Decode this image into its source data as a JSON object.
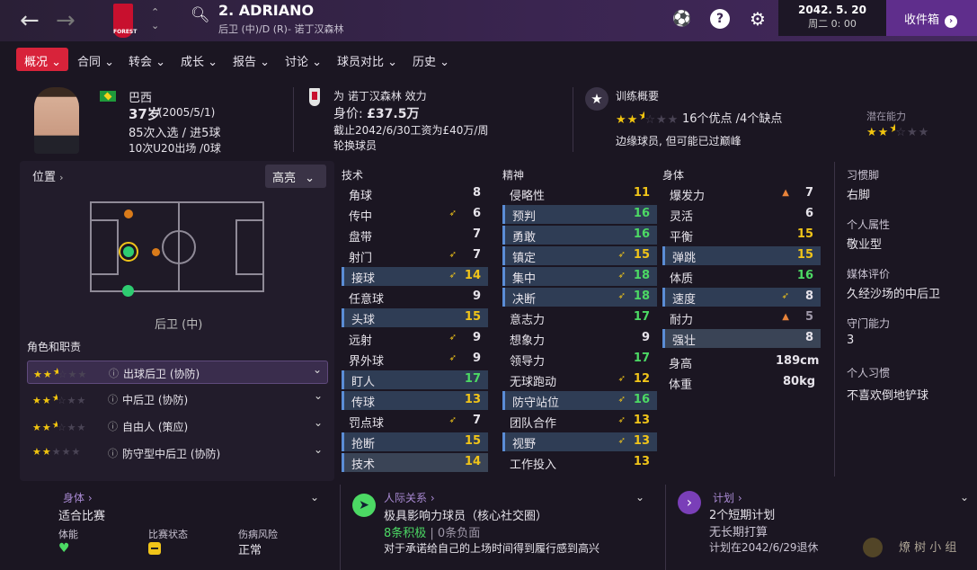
{
  "header": {
    "player_name": "2. ADRIANO",
    "player_sub": "后卫 (中)/D (R)- 诺丁汉森林",
    "club_badge_text": "FOREST",
    "date": "2042. 5. 20",
    "day_time": "周二 0: 00",
    "inbox": "收件箱"
  },
  "tabs": [
    "概况",
    "合同",
    "转会",
    "成长",
    "报告",
    "讨论",
    "球员对比",
    "历史"
  ],
  "profile": {
    "nation": "巴西",
    "age": "37岁",
    "dob": "(2005/5/1)",
    "caps": "85次入选 / 进5球",
    "u20": "10次U20出场 /0球"
  },
  "contract": {
    "club": "为 诺丁汉森林 效力",
    "value_label": "身价: ",
    "value": "£37.5万",
    "until": "截止2042/6/30工资为£40万/周",
    "status": "轮换球员"
  },
  "training": {
    "title": "训练概要",
    "summary": "16个优点 /4个缺点",
    "note": "边缘球员, 但可能已过巅峰",
    "pot_label": "潜在能力",
    "current_stars": 2.5,
    "potential_stars": 2.5
  },
  "position": {
    "label": "位置",
    "brightness": "高亮",
    "pos_name": "后卫 (中)",
    "roles_title": "角色和职责"
  },
  "roles": [
    {
      "name": "出球后卫 (协防)",
      "stars": 2.5
    },
    {
      "name": "中后卫 (协防)",
      "stars": 2.5
    },
    {
      "name": "自由人 (策应)",
      "stars": 2.5
    },
    {
      "name": "防守型中后卫 (协防)",
      "stars": 2
    }
  ],
  "columns": {
    "technical": "技术",
    "mental": "精神",
    "physical": "身体"
  },
  "technical": [
    [
      "角球",
      "8",
      "",
      "",
      "white"
    ],
    [
      "传中",
      "6",
      "y",
      "",
      "white"
    ],
    [
      "盘带",
      "7",
      "",
      "",
      "white"
    ],
    [
      "射门",
      "7",
      "y",
      "",
      "white"
    ],
    [
      "接球",
      "14",
      "y",
      "hl",
      "yellow"
    ],
    [
      "任意球",
      "9",
      "",
      "",
      "white"
    ],
    [
      "头球",
      "15",
      "",
      "hl",
      "yellow"
    ],
    [
      "远射",
      "9",
      "y",
      "",
      "white"
    ],
    [
      "界外球",
      "9",
      "y",
      "",
      "white"
    ],
    [
      "盯人",
      "17",
      "",
      "hl",
      "green"
    ],
    [
      "传球",
      "13",
      "",
      "hl",
      "yellow"
    ],
    [
      "罚点球",
      "7",
      "y",
      "",
      "white"
    ],
    [
      "抢断",
      "15",
      "",
      "hl",
      "yellow"
    ],
    [
      "技术",
      "14",
      "",
      "hl2",
      "yellow"
    ]
  ],
  "mental": [
    [
      "侵略性",
      "11",
      "",
      "",
      "yellow"
    ],
    [
      "预判",
      "16",
      "",
      "hl",
      "green"
    ],
    [
      "勇敢",
      "16",
      "",
      "hl",
      "green"
    ],
    [
      "镇定",
      "15",
      "y",
      "hl",
      "yellow"
    ],
    [
      "集中",
      "18",
      "y",
      "hl",
      "green"
    ],
    [
      "决断",
      "18",
      "y",
      "hl",
      "green"
    ],
    [
      "意志力",
      "17",
      "",
      "",
      "green"
    ],
    [
      "想象力",
      "9",
      "",
      "",
      "white"
    ],
    [
      "领导力",
      "17",
      "",
      "",
      "green"
    ],
    [
      "无球跑动",
      "12",
      "y",
      "",
      "yellow"
    ],
    [
      "防守站位",
      "16",
      "y",
      "hl",
      "green"
    ],
    [
      "团队合作",
      "13",
      "y",
      "",
      "yellow"
    ],
    [
      "视野",
      "13",
      "y",
      "hl",
      "yellow"
    ],
    [
      "工作投入",
      "13",
      "",
      "",
      "yellow"
    ]
  ],
  "physical": [
    [
      "爆发力",
      "7",
      "o",
      "",
      "white"
    ],
    [
      "灵活",
      "6",
      "",
      "",
      "white"
    ],
    [
      "平衡",
      "15",
      "",
      "",
      "yellow"
    ],
    [
      "弹跳",
      "15",
      "",
      "hl",
      "yellow"
    ],
    [
      "体质",
      "16",
      "",
      "",
      "green"
    ],
    [
      "速度",
      "8",
      "y",
      "hl",
      "white"
    ],
    [
      "耐力",
      "5",
      "o",
      "",
      "dim"
    ],
    [
      "强壮",
      "8",
      "",
      "hl2",
      "white"
    ]
  ],
  "body": {
    "height_label": "身高",
    "height": "189cm",
    "weight_label": "体重",
    "weight": "80kg"
  },
  "traits": {
    "foot_label": "习惯脚",
    "foot": "右脚",
    "personality_label": "个人属性",
    "personality": "敬业型",
    "media_label": "媒体评价",
    "media": "久经沙场的中后卫",
    "keeper_label": "守门能力",
    "keeper": "3",
    "habits_label": "个人习惯",
    "habits": "不喜欢倒地铲球"
  },
  "bottom": {
    "body_title": "身体",
    "body_status": "适合比赛",
    "fitness_label": "体能",
    "match_label": "比赛状态",
    "injury_label": "伤病风险",
    "injury": "正常",
    "rel_title": "人际关系",
    "rel_line": "极具影响力球员（核心社交圈）",
    "rel_pos": "8条积极",
    "rel_neg": " | 0条负面",
    "rel_note": "对于承诺给自己的上场时间得到履行感到高兴",
    "plan_title": "计划",
    "plan_line": "2个短期计划",
    "plan_long": "无长期打算",
    "plan_retire": "计划在2042/6/29退休",
    "watermark": "燎 树 小 组"
  },
  "colors": {
    "accent": "#d8233a",
    "inbox": "#5f2e8c",
    "green": "#4cd964",
    "yellow": "#f0c419"
  }
}
